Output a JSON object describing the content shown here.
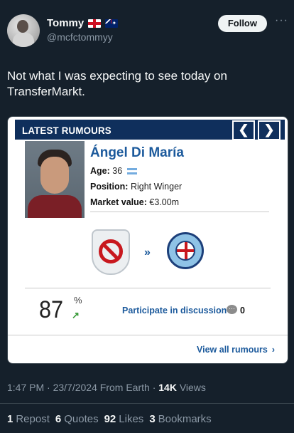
{
  "author": {
    "name": "Tommy",
    "handle": "@mcfctommyy",
    "flags": [
      "england-flag",
      "australia-flag"
    ]
  },
  "follow_label": "Follow",
  "more_label": "···",
  "tweet_text": "Not what I was expecting to see today on TransferMarkt.",
  "card": {
    "bar_title": "LATEST RUMOURS",
    "prev_label": "❮",
    "next_label": "❯",
    "player": {
      "name": "Ángel Di María",
      "age_label": "Age:",
      "age_value": "36",
      "position_label": "Position:",
      "position_value": "Right Winger",
      "market_label": "Market value:",
      "market_value": "€3.00m"
    },
    "from_club_icon": "no-club-crest",
    "to_club_icon": "melbourne-city-crest",
    "transfer_arrow": "»",
    "probability": "87",
    "probability_unit": "%",
    "trend_arrow": "↗",
    "discussion_label": "Participate in discussion",
    "discussion_count": "0",
    "view_all_label": "View all rumours",
    "view_all_chevron": "›"
  },
  "meta": {
    "time": "1:47 PM",
    "date": "23/7/2024",
    "source": "From Earth",
    "views_count": "14K",
    "views_label": "Views"
  },
  "stats": {
    "reposts_count": "1",
    "reposts_label": "Repost",
    "quotes_count": "6",
    "quotes_label": "Quotes",
    "likes_count": "92",
    "likes_label": "Likes",
    "bookmarks_count": "3",
    "bookmarks_label": "Bookmarks"
  },
  "colors": {
    "background": "#15202b",
    "card_header": "#0f2f5c",
    "link_blue": "#1c5a9c",
    "follow_button": "#eff3f4"
  }
}
